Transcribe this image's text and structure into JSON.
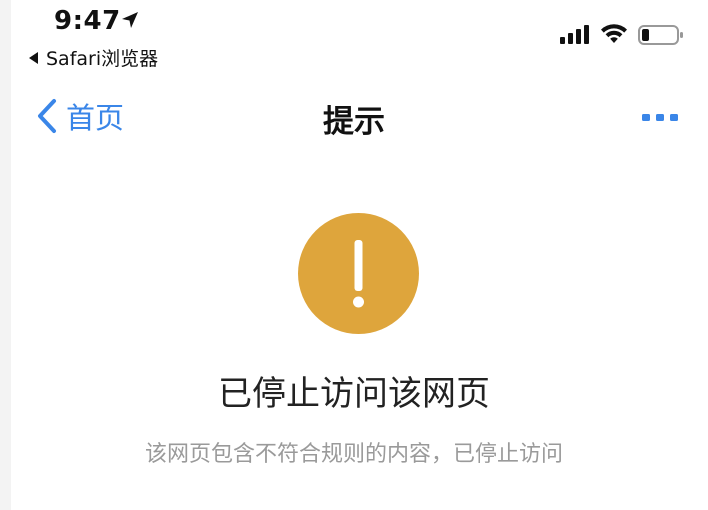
{
  "status_bar": {
    "time": "9:47",
    "back_app_label": "Safari浏览器",
    "location_icon": "location-arrow-icon",
    "signal_icon": "cellular-signal-icon",
    "wifi_icon": "wifi-icon",
    "battery_icon": "battery-icon",
    "battery_level": 0.2
  },
  "nav": {
    "back_label": "首页",
    "title": "提示",
    "back_icon": "chevron-left-icon",
    "more_icon": "more-dots-icon",
    "accent_color": "#3a86e8"
  },
  "notice": {
    "icon": "warning-exclamation-icon",
    "icon_color": "#dea53c",
    "headline": "已停止访问该网页",
    "message": "该网页包含不符合规则的内容，已停止访问"
  }
}
